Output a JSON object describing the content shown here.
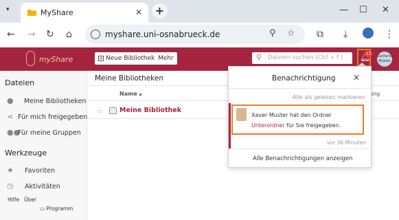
{
  "browser": {
    "tab_title": "MyShare",
    "url": "myshare.uni-osnabrueck.de"
  },
  "app": {
    "logo_text": "myShare",
    "new_library_label": "Neue Bibliothek",
    "more_label": "Mehr",
    "search_placeholder": "Dateien suchen (Ctrl + f )",
    "notification_count": "13",
    "avatar_text": "Zacharias Muster"
  },
  "sidebar": {
    "files_heading": "Dateien",
    "files_items": [
      {
        "label": "Meine Bibliotheken",
        "icon": "person-icon"
      },
      {
        "label": "Für mich freigegeben",
        "icon": "share-icon"
      },
      {
        "label": "Für meine Gruppen",
        "icon": "group-icon"
      }
    ],
    "tools_heading": "Werkzeuge",
    "tools_items": [
      {
        "label": "Favoriten",
        "icon": "star-icon"
      },
      {
        "label": "Aktivitäten",
        "icon": "clock-icon"
      }
    ],
    "footer": {
      "help": "Hilfe",
      "about": "Über",
      "program": "Programm"
    }
  },
  "main": {
    "heading": "Meine Bibliotheken",
    "col_name": "Name ▴",
    "col_cut": "ung",
    "library_name": "Meine Bibliothek"
  },
  "notifications": {
    "title": "Benachrichtigung",
    "mark_all_read": "Alle als gelesen markieren",
    "item": {
      "text_before": "Xaver Muster hat den Ordner ",
      "link": "Unterordner",
      "text_after": " für Sie freigegeben.",
      "time": "vor 36 Minuten"
    },
    "show_all": "Alle Benachrichtigungen anzeigen"
  },
  "colors": {
    "brand": "#a52540",
    "highlight": "#f07828"
  }
}
